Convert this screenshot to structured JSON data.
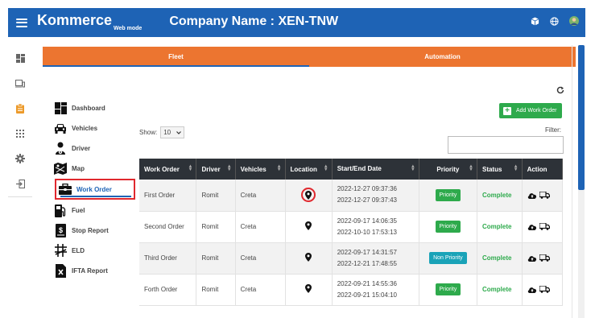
{
  "header": {
    "brand": "Kommerce",
    "brand_sub": "Web mode",
    "company": "Company Name : XEN-TNW"
  },
  "tabs": [
    "Fleet",
    "Automation"
  ],
  "active_tab": "Fleet",
  "add_button": "Add Work Order",
  "sidebar": {
    "items": [
      {
        "label": "Dashboard",
        "icon": "dashboard-icon"
      },
      {
        "label": "Vehicles",
        "icon": "car-icon"
      },
      {
        "label": "Driver",
        "icon": "driver-icon"
      },
      {
        "label": "Map",
        "icon": "map-icon"
      },
      {
        "label": "Work Order",
        "icon": "briefcase-icon",
        "active": true
      },
      {
        "label": "Fuel",
        "icon": "fuel-icon"
      },
      {
        "label": "Stop Report",
        "icon": "report-icon"
      },
      {
        "label": "ELD",
        "icon": "eld-icon"
      },
      {
        "label": "IFTA Report",
        "icon": "ifta-icon"
      }
    ]
  },
  "table_controls": {
    "show_label": "Show:",
    "show_value": "10",
    "filter_label": "Filter:"
  },
  "table": {
    "columns": [
      "Work Order",
      "Driver",
      "Vehicles",
      "Location",
      "Start/End Date",
      "Priority",
      "Status",
      "Action"
    ],
    "rows": [
      {
        "work_order": "First Order",
        "driver": "Romit",
        "vehicle": "Creta",
        "start": "2022-12-27 09:37:36",
        "end": "2022-12-27 09:37:43",
        "priority": "Priority",
        "status": "Complete",
        "highlight_location": true
      },
      {
        "work_order": "Second Order",
        "driver": "Romit",
        "vehicle": "Creta",
        "start": "2022-09-17 14:06:35",
        "end": "2022-10-10 17:53:13",
        "priority": "Priority",
        "status": "Complete"
      },
      {
        "work_order": "Third Order",
        "driver": "Romit",
        "vehicle": "Creta",
        "start": "2022-09-17 14:31:57",
        "end": "2022-12-21 17:48:55",
        "priority": "Non Priority",
        "status": "Complete"
      },
      {
        "work_order": "Forth Order",
        "driver": "Romit",
        "vehicle": "Creta",
        "start": "2022-09-21 14:55:36",
        "end": "2022-09-21 15:04:10",
        "priority": "Priority",
        "status": "Complete"
      }
    ]
  },
  "colors": {
    "primary": "#1e63b5",
    "tab": "#ec7530",
    "success": "#2eaa4c",
    "info": "#1aa3b8",
    "highlight": "#e0282e",
    "header_dark": "#2d3238"
  }
}
